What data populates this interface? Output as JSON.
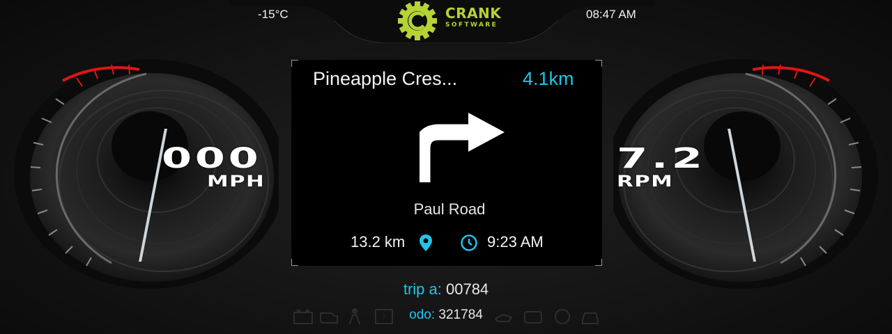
{
  "header": {
    "temperature": "-15°C",
    "clock": "08:47 AM",
    "logo_name": "CRANK",
    "logo_subtitle": "SOFTWARE"
  },
  "speedometer": {
    "value": "000",
    "unit": "MPH"
  },
  "tachometer": {
    "value": "7.2",
    "unit": "RPM"
  },
  "navigation": {
    "street": "Pineapple Cres...",
    "distance_to_turn": "4.1km",
    "turn_icon": "turn-right-icon",
    "next_road": "Paul Road",
    "remaining_distance": "13.2 km",
    "eta": "9:23 AM"
  },
  "trip": {
    "label": "trip a:",
    "value": "00784"
  },
  "odometer": {
    "label": "odo:",
    "value": "321784"
  },
  "colors": {
    "accent": "#21c4ea",
    "brand": "#b5d334",
    "redline": "#e01515"
  }
}
